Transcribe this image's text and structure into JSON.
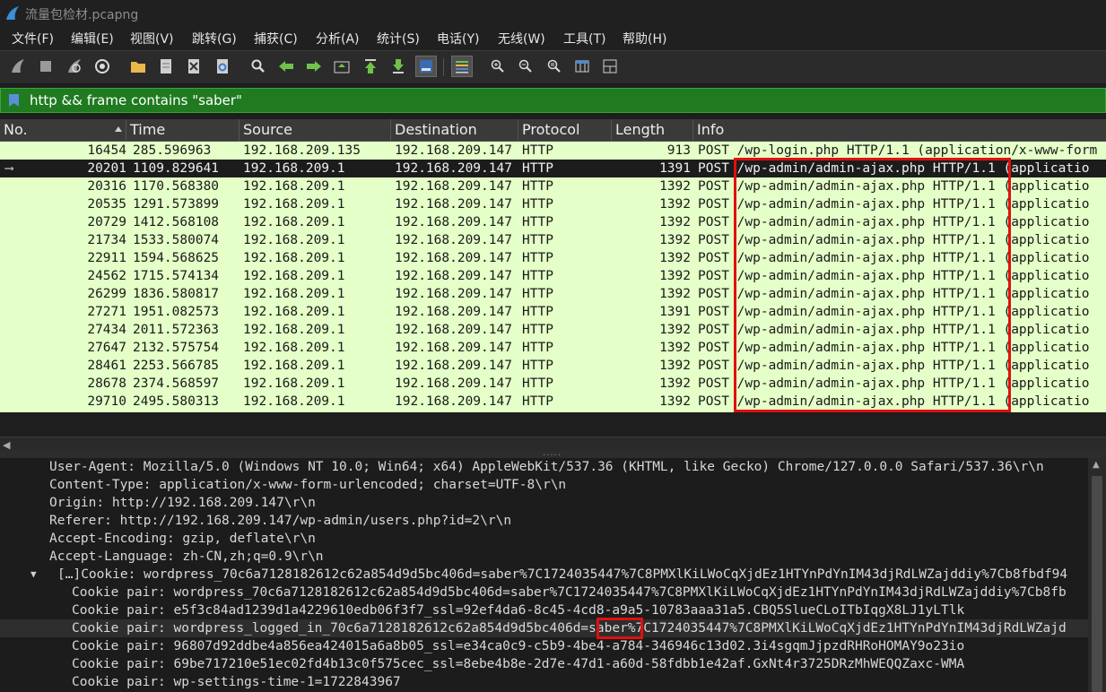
{
  "window": {
    "title": "流量包检材.pcapng"
  },
  "menu": [
    "文件(F)",
    "编辑(E)",
    "视图(V)",
    "跳转(G)",
    "捕获(C)",
    "分析(A)",
    "统计(S)",
    "电话(Y)",
    "无线(W)",
    "工具(T)",
    "帮助(H)"
  ],
  "toolbar": {
    "icons": [
      "shark-fin-start-icon",
      "stop-icon",
      "restart-icon",
      "options-gear-icon",
      "open-folder-icon",
      "file-icon",
      "close-file-icon",
      "reload-icon",
      "find-icon",
      "back-arrow-icon",
      "forward-arrow-icon",
      "goto-packet-icon",
      "first-packet-icon",
      "last-packet-icon",
      "autoscroll-icon",
      "colorize-icon",
      "zoom-in-icon",
      "zoom-out-icon",
      "zoom-normal-icon",
      "resize-columns-icon",
      "layout-icon"
    ]
  },
  "filter": {
    "value": "http && frame contains \"saber\""
  },
  "columns": [
    "No.",
    "Time",
    "Source",
    "Destination",
    "Protocol",
    "Length",
    "Info"
  ],
  "packets": [
    {
      "no": "16454",
      "time": "285.596963",
      "src": "192.168.209.135",
      "dst": "192.168.209.147",
      "proto": "HTTP",
      "len": "913",
      "info": "POST /wp-login.php HTTP/1.1  (application/x-www-form"
    },
    {
      "no": "20201",
      "time": "1109.829641",
      "src": "192.168.209.1",
      "dst": "192.168.209.147",
      "proto": "HTTP",
      "len": "1391",
      "info": "POST /wp-admin/admin-ajax.php HTTP/1.1  (applicatio"
    },
    {
      "no": "20316",
      "time": "1170.568380",
      "src": "192.168.209.1",
      "dst": "192.168.209.147",
      "proto": "HTTP",
      "len": "1392",
      "info": "POST /wp-admin/admin-ajax.php HTTP/1.1  (applicatio"
    },
    {
      "no": "20535",
      "time": "1291.573899",
      "src": "192.168.209.1",
      "dst": "192.168.209.147",
      "proto": "HTTP",
      "len": "1392",
      "info": "POST /wp-admin/admin-ajax.php HTTP/1.1  (applicatio"
    },
    {
      "no": "20729",
      "time": "1412.568108",
      "src": "192.168.209.1",
      "dst": "192.168.209.147",
      "proto": "HTTP",
      "len": "1392",
      "info": "POST /wp-admin/admin-ajax.php HTTP/1.1  (applicatio"
    },
    {
      "no": "21734",
      "time": "1533.580074",
      "src": "192.168.209.1",
      "dst": "192.168.209.147",
      "proto": "HTTP",
      "len": "1392",
      "info": "POST /wp-admin/admin-ajax.php HTTP/1.1  (applicatio"
    },
    {
      "no": "22911",
      "time": "1594.568625",
      "src": "192.168.209.1",
      "dst": "192.168.209.147",
      "proto": "HTTP",
      "len": "1392",
      "info": "POST /wp-admin/admin-ajax.php HTTP/1.1  (applicatio"
    },
    {
      "no": "24562",
      "time": "1715.574134",
      "src": "192.168.209.1",
      "dst": "192.168.209.147",
      "proto": "HTTP",
      "len": "1392",
      "info": "POST /wp-admin/admin-ajax.php HTTP/1.1  (applicatio"
    },
    {
      "no": "26299",
      "time": "1836.580817",
      "src": "192.168.209.1",
      "dst": "192.168.209.147",
      "proto": "HTTP",
      "len": "1392",
      "info": "POST /wp-admin/admin-ajax.php HTTP/1.1  (applicatio"
    },
    {
      "no": "27271",
      "time": "1951.082573",
      "src": "192.168.209.1",
      "dst": "192.168.209.147",
      "proto": "HTTP",
      "len": "1391",
      "info": "POST /wp-admin/admin-ajax.php HTTP/1.1  (applicatio"
    },
    {
      "no": "27434",
      "time": "2011.572363",
      "src": "192.168.209.1",
      "dst": "192.168.209.147",
      "proto": "HTTP",
      "len": "1392",
      "info": "POST /wp-admin/admin-ajax.php HTTP/1.1  (applicatio"
    },
    {
      "no": "27647",
      "time": "2132.575754",
      "src": "192.168.209.1",
      "dst": "192.168.209.147",
      "proto": "HTTP",
      "len": "1392",
      "info": "POST /wp-admin/admin-ajax.php HTTP/1.1  (applicatio"
    },
    {
      "no": "28461",
      "time": "2253.566785",
      "src": "192.168.209.1",
      "dst": "192.168.209.147",
      "proto": "HTTP",
      "len": "1392",
      "info": "POST /wp-admin/admin-ajax.php HTTP/1.1  (applicatio"
    },
    {
      "no": "28678",
      "time": "2374.568597",
      "src": "192.168.209.1",
      "dst": "192.168.209.147",
      "proto": "HTTP",
      "len": "1392",
      "info": "POST /wp-admin/admin-ajax.php HTTP/1.1  (applicatio"
    },
    {
      "no": "29710",
      "time": "2495.580313",
      "src": "192.168.209.1",
      "dst": "192.168.209.147",
      "proto": "HTTP",
      "len": "1392",
      "info": "POST /wp-admin/admin-ajax.php HTTP/1.1  (applicatio"
    }
  ],
  "selected_packet": "20201",
  "details": [
    {
      "text": "User-Agent: Mozilla/5.0 (Windows NT 10.0; Win64; x64) AppleWebKit/537.36 (KHTML, like Gecko) Chrome/127.0.0.0 Safari/537.36\\r\\n",
      "level": 1
    },
    {
      "text": "Content-Type: application/x-www-form-urlencoded; charset=UTF-8\\r\\n",
      "level": 1
    },
    {
      "text": "Origin: http://192.168.209.147\\r\\n",
      "level": 1
    },
    {
      "text": "Referer: http://192.168.209.147/wp-admin/users.php?id=2\\r\\n",
      "level": 1
    },
    {
      "text": "Accept-Encoding: gzip, deflate\\r\\n",
      "level": 1
    },
    {
      "text": "Accept-Language: zh-CN,zh;q=0.9\\r\\n",
      "level": 1
    },
    {
      "text": "[…]Cookie: wordpress_70c6a7128182612c62a854d9d5bc406d=saber%7C1724035447%7C8PMXlKiLWoCqXjdEz1HTYnPdYnIM43djRdLWZajddiy%7Cb8fbdf94",
      "level": 1,
      "expanded": true
    },
    {
      "text": "Cookie pair: wordpress_70c6a7128182612c62a854d9d5bc406d=saber%7C1724035447%7C8PMXlKiLWoCqXjdEz1HTYnPdYnIM43djRdLWZajddiy%7Cb8fb",
      "level": 2
    },
    {
      "text": "Cookie pair: e5f3c84ad1239d1a4229610edb06f3f7_ssl=92ef4da6-8c45-4cd8-a9a5-10783aaa31a5.CBQ5SlueCLoITbIqgX8LJ1yLTlk",
      "level": 2
    },
    {
      "text": "Cookie pair: wordpress_logged_in_70c6a7128182612c62a854d9d5bc406d=saber%7C1724035447%7C8PMXlKiLWoCqXjdEz1HTYnPdYnIM43djRdLWZajd",
      "level": 2,
      "highlight": true
    },
    {
      "text": "Cookie pair: 96807d92ddbe4a856ea424015a6a8b05_ssl=e34ca0c9-c5b9-4be4-a784-346946c13d02.3i4sgqmJjpzdRHRoHOMAY9o23io",
      "level": 2
    },
    {
      "text": "Cookie pair: 69be717210e51ec02fd4b13c0f575cec_ssl=8ebe4b8e-2d7e-47d1-a60d-58fdbb1e42af.GxNt4r3725DRzMhWEQQZaxc-WMA",
      "level": 2
    },
    {
      "text": "Cookie pair: wp-settings-time-1=1722843967",
      "level": 2
    }
  ],
  "colors": {
    "packet_row_bg": "#e4ffc7",
    "filter_bg": "#207a20",
    "annotation": "#e01010",
    "selected_row_bg": "#1c1c1c"
  }
}
